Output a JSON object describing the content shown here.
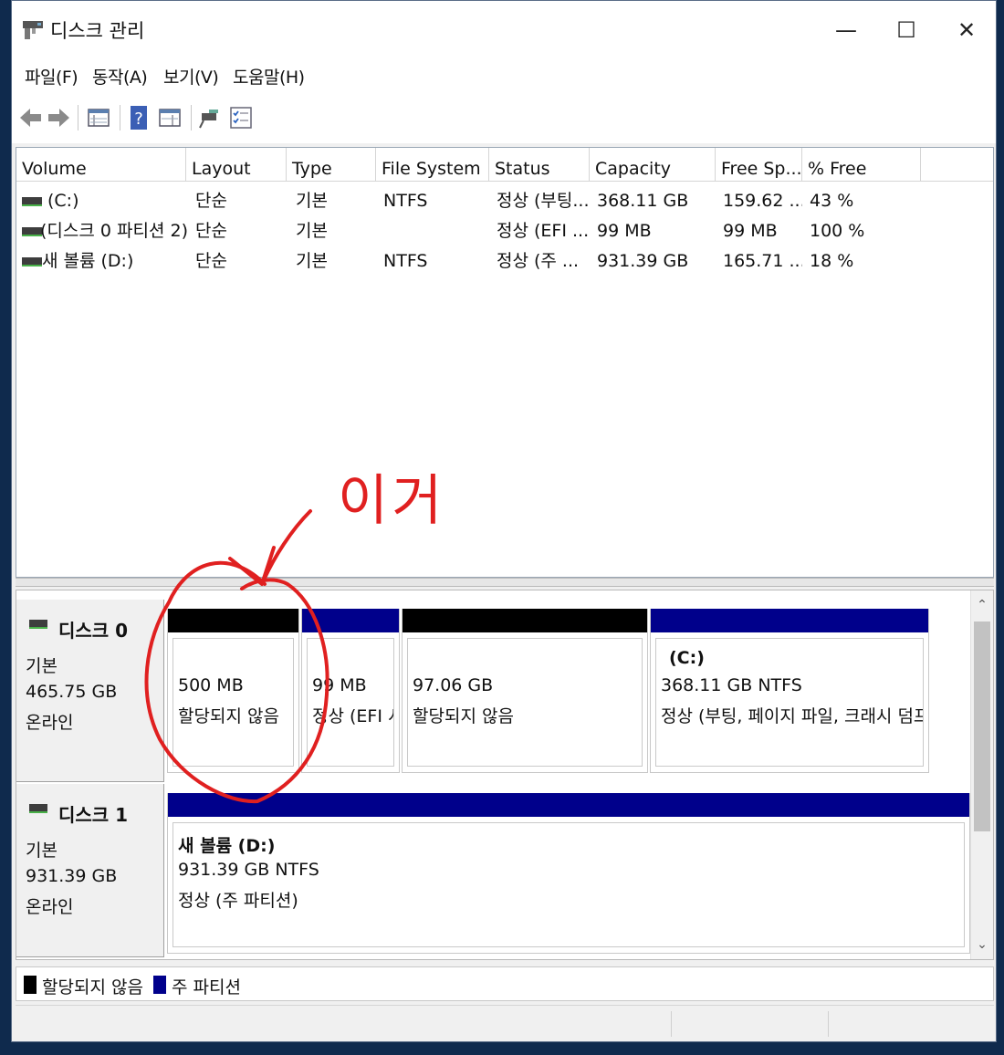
{
  "window": {
    "title": "디스크 관리",
    "caption": {
      "minimize": "—",
      "maximize": "☐",
      "close": "✕"
    }
  },
  "menu": [
    "파일(F)",
    "동작(A)",
    "보기(V)",
    "도움말(H)"
  ],
  "toolbar": {
    "icons": [
      "back-arrow-icon",
      "forward-arrow-icon",
      "disk-view-icon",
      "help-icon",
      "properties-icon",
      "connect-icon",
      "checklist-icon"
    ]
  },
  "columns": [
    "Volume",
    "Layout",
    "Type",
    "File System",
    "Status",
    "Capacity",
    "Free Sp...",
    "% Free"
  ],
  "volumes": [
    {
      "volume": "(C:)",
      "layout": "단순",
      "type": "기본",
      "fs": "NTFS",
      "status": "정상 (부팅...",
      "capacity": "368.11 GB",
      "free": "159.62 ...",
      "pct": "43 %"
    },
    {
      "volume": "(디스크 0 파티션 2)",
      "layout": "단순",
      "type": "기본",
      "fs": "",
      "status": "정상 (EFI ...",
      "capacity": "99 MB",
      "free": "99 MB",
      "pct": "100 %"
    },
    {
      "volume": "새 볼륨 (D:)",
      "layout": "단순",
      "type": "기본",
      "fs": "NTFS",
      "status": "정상 (주 ...",
      "capacity": "931.39 GB",
      "free": "165.71 ...",
      "pct": "18 %"
    }
  ],
  "disks": [
    {
      "name": "디스크 0",
      "type": "기본",
      "size": "465.75 GB",
      "state": "온라인",
      "partitions": [
        {
          "kind": "unallocated",
          "title": "",
          "line1": "500 MB",
          "line2": "할당되지 않음"
        },
        {
          "kind": "primary",
          "title": "",
          "line1": "99 MB",
          "line2": "정상 (EFI 시"
        },
        {
          "kind": "unallocated",
          "title": "",
          "line1": "97.06 GB",
          "line2": "할당되지 않음"
        },
        {
          "kind": "primary",
          "title": "(C:)",
          "line1": "368.11 GB NTFS",
          "line2": "정상 (부팅, 페이지 파일, 크래시 덤프,"
        }
      ]
    },
    {
      "name": "디스크 1",
      "type": "기본",
      "size": "931.39 GB",
      "state": "온라인",
      "partitions": [
        {
          "kind": "primary",
          "title": "새 볼륨  (D:)",
          "line1": "931.39 GB NTFS",
          "line2": "정상 (주 파티션)"
        }
      ]
    }
  ],
  "legend": {
    "unallocated": "할당되지 않음",
    "primary": "주 파티션"
  },
  "colors": {
    "unallocated": "#000000",
    "primary": "#00008b",
    "annotation": "#e02020"
  },
  "annotation": {
    "text": "이거"
  }
}
